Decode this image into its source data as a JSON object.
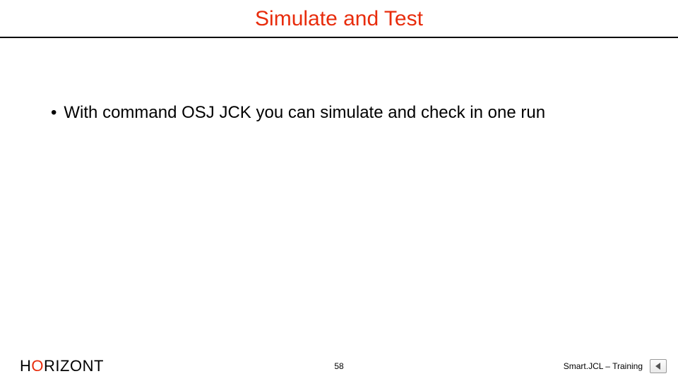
{
  "title": "Simulate and Test",
  "bullets": [
    "With command OSJ JCK you can simulate and check in one run"
  ],
  "brand": {
    "pre": "H",
    "accent": "O",
    "post": "RIZONT"
  },
  "page_number": "58",
  "doc_title": "Smart.JCL – Training",
  "nav": {
    "back_icon": "back-arrow"
  }
}
